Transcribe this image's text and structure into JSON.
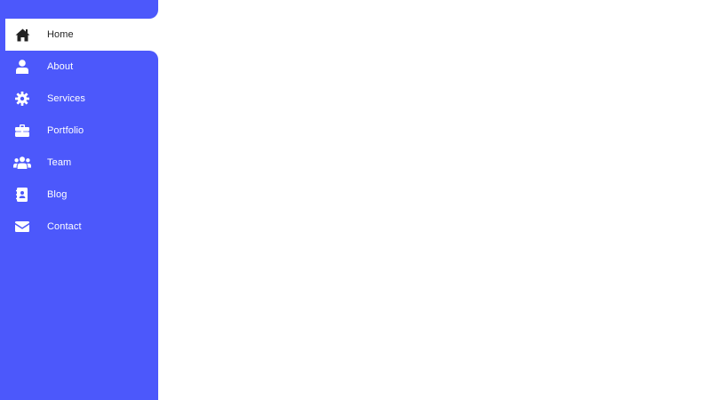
{
  "colors": {
    "sidebar_bg": "#4c58fb",
    "active_bg": "#ffffff",
    "active_text": "#222222",
    "text": "#ffffff"
  },
  "sidebar": {
    "active_index": 0,
    "items": [
      {
        "label": "Home",
        "icon": "home-icon"
      },
      {
        "label": "About",
        "icon": "user-icon"
      },
      {
        "label": "Services",
        "icon": "gear-icon"
      },
      {
        "label": "Portfolio",
        "icon": "briefcase-icon"
      },
      {
        "label": "Team",
        "icon": "users-icon"
      },
      {
        "label": "Blog",
        "icon": "address-book-icon"
      },
      {
        "label": "Contact",
        "icon": "envelope-icon"
      }
    ]
  }
}
